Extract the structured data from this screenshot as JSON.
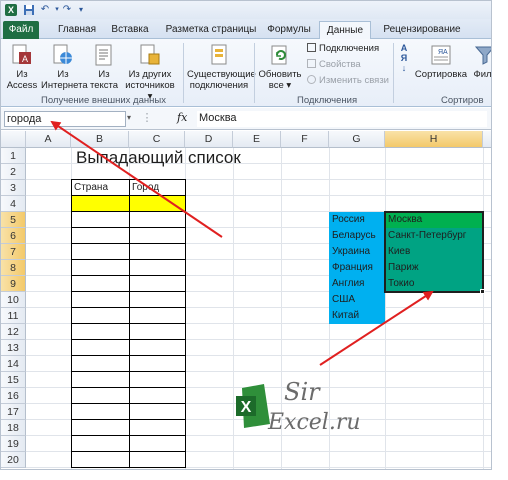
{
  "tabs": [
    {
      "key": "file",
      "label": "Файл"
    },
    {
      "key": "home",
      "label": "Главная"
    },
    {
      "key": "insert",
      "label": "Вставка"
    },
    {
      "key": "layout",
      "label": "Разметка страницы"
    },
    {
      "key": "formulas",
      "label": "Формулы"
    },
    {
      "key": "data",
      "label": "Данные"
    },
    {
      "key": "review",
      "label": "Рецензирование"
    }
  ],
  "ribbon": {
    "external": {
      "access": "Из Access",
      "web": "Из Интернета",
      "text": "Из текста",
      "other": "Из других источников ▾",
      "group_label": "Получение внешних данных"
    },
    "existing_connections": "Существующие подключения",
    "connections": {
      "refresh_all": "Обновить все ▾",
      "connections": "Подключения",
      "properties": "Свойства",
      "edit_links": "Изменить связи",
      "group_label": "Подключения"
    },
    "sort": {
      "sort": "Сортировка",
      "filter": "Филь",
      "group_label": "Сортиров"
    }
  },
  "formula_bar": {
    "name_box": "города",
    "fx": "fx",
    "value": "Москва"
  },
  "columns": [
    "A",
    "B",
    "C",
    "D",
    "E",
    "F",
    "G",
    "H"
  ],
  "rows": [
    "1",
    "2",
    "3",
    "4",
    "5",
    "6",
    "7",
    "8",
    "9",
    "10",
    "11",
    "12",
    "13",
    "14",
    "15",
    "16",
    "17",
    "18",
    "19",
    "20"
  ],
  "sheet": {
    "title": "Выпадающий список",
    "header_country": "Страна",
    "header_city": "Город",
    "countries": [
      "Россия",
      "Беларусь",
      "Украина",
      "Франция",
      "Англия",
      "США",
      "Китай"
    ],
    "cities": [
      "Москва",
      "Санкт-Петербург",
      "Киев",
      "Париж",
      "Токио"
    ]
  },
  "logo": {
    "line1": "Sir",
    "line2": "Excel.ru"
  },
  "colors": {
    "yellow": "#ffff00",
    "country_fill": "#00b0f0",
    "city_fill": "#00a383",
    "moscow_fill": "#00b050",
    "arrow": "#e02020"
  }
}
